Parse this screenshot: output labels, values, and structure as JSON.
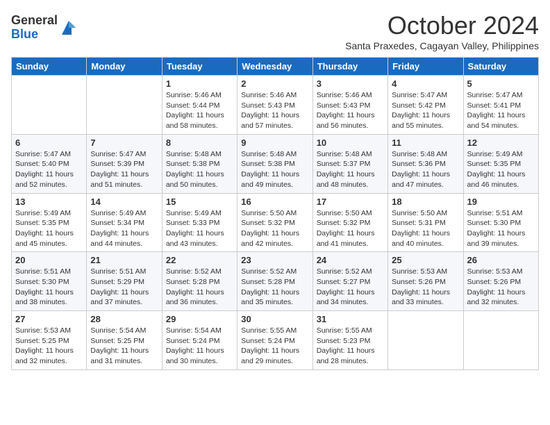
{
  "logo": {
    "general": "General",
    "blue": "Blue"
  },
  "title": "October 2024",
  "subtitle": "Santa Praxedes, Cagayan Valley, Philippines",
  "days_header": [
    "Sunday",
    "Monday",
    "Tuesday",
    "Wednesday",
    "Thursday",
    "Friday",
    "Saturday"
  ],
  "weeks": [
    [
      {
        "day": "",
        "sunrise": "",
        "sunset": "",
        "daylight": ""
      },
      {
        "day": "",
        "sunrise": "",
        "sunset": "",
        "daylight": ""
      },
      {
        "day": "1",
        "sunrise": "Sunrise: 5:46 AM",
        "sunset": "Sunset: 5:44 PM",
        "daylight": "Daylight: 11 hours and 58 minutes."
      },
      {
        "day": "2",
        "sunrise": "Sunrise: 5:46 AM",
        "sunset": "Sunset: 5:43 PM",
        "daylight": "Daylight: 11 hours and 57 minutes."
      },
      {
        "day": "3",
        "sunrise": "Sunrise: 5:46 AM",
        "sunset": "Sunset: 5:43 PM",
        "daylight": "Daylight: 11 hours and 56 minutes."
      },
      {
        "day": "4",
        "sunrise": "Sunrise: 5:47 AM",
        "sunset": "Sunset: 5:42 PM",
        "daylight": "Daylight: 11 hours and 55 minutes."
      },
      {
        "day": "5",
        "sunrise": "Sunrise: 5:47 AM",
        "sunset": "Sunset: 5:41 PM",
        "daylight": "Daylight: 11 hours and 54 minutes."
      }
    ],
    [
      {
        "day": "6",
        "sunrise": "Sunrise: 5:47 AM",
        "sunset": "Sunset: 5:40 PM",
        "daylight": "Daylight: 11 hours and 52 minutes."
      },
      {
        "day": "7",
        "sunrise": "Sunrise: 5:47 AM",
        "sunset": "Sunset: 5:39 PM",
        "daylight": "Daylight: 11 hours and 51 minutes."
      },
      {
        "day": "8",
        "sunrise": "Sunrise: 5:48 AM",
        "sunset": "Sunset: 5:38 PM",
        "daylight": "Daylight: 11 hours and 50 minutes."
      },
      {
        "day": "9",
        "sunrise": "Sunrise: 5:48 AM",
        "sunset": "Sunset: 5:38 PM",
        "daylight": "Daylight: 11 hours and 49 minutes."
      },
      {
        "day": "10",
        "sunrise": "Sunrise: 5:48 AM",
        "sunset": "Sunset: 5:37 PM",
        "daylight": "Daylight: 11 hours and 48 minutes."
      },
      {
        "day": "11",
        "sunrise": "Sunrise: 5:48 AM",
        "sunset": "Sunset: 5:36 PM",
        "daylight": "Daylight: 11 hours and 47 minutes."
      },
      {
        "day": "12",
        "sunrise": "Sunrise: 5:49 AM",
        "sunset": "Sunset: 5:35 PM",
        "daylight": "Daylight: 11 hours and 46 minutes."
      }
    ],
    [
      {
        "day": "13",
        "sunrise": "Sunrise: 5:49 AM",
        "sunset": "Sunset: 5:35 PM",
        "daylight": "Daylight: 11 hours and 45 minutes."
      },
      {
        "day": "14",
        "sunrise": "Sunrise: 5:49 AM",
        "sunset": "Sunset: 5:34 PM",
        "daylight": "Daylight: 11 hours and 44 minutes."
      },
      {
        "day": "15",
        "sunrise": "Sunrise: 5:49 AM",
        "sunset": "Sunset: 5:33 PM",
        "daylight": "Daylight: 11 hours and 43 minutes."
      },
      {
        "day": "16",
        "sunrise": "Sunrise: 5:50 AM",
        "sunset": "Sunset: 5:32 PM",
        "daylight": "Daylight: 11 hours and 42 minutes."
      },
      {
        "day": "17",
        "sunrise": "Sunrise: 5:50 AM",
        "sunset": "Sunset: 5:32 PM",
        "daylight": "Daylight: 11 hours and 41 minutes."
      },
      {
        "day": "18",
        "sunrise": "Sunrise: 5:50 AM",
        "sunset": "Sunset: 5:31 PM",
        "daylight": "Daylight: 11 hours and 40 minutes."
      },
      {
        "day": "19",
        "sunrise": "Sunrise: 5:51 AM",
        "sunset": "Sunset: 5:30 PM",
        "daylight": "Daylight: 11 hours and 39 minutes."
      }
    ],
    [
      {
        "day": "20",
        "sunrise": "Sunrise: 5:51 AM",
        "sunset": "Sunset: 5:30 PM",
        "daylight": "Daylight: 11 hours and 38 minutes."
      },
      {
        "day": "21",
        "sunrise": "Sunrise: 5:51 AM",
        "sunset": "Sunset: 5:29 PM",
        "daylight": "Daylight: 11 hours and 37 minutes."
      },
      {
        "day": "22",
        "sunrise": "Sunrise: 5:52 AM",
        "sunset": "Sunset: 5:28 PM",
        "daylight": "Daylight: 11 hours and 36 minutes."
      },
      {
        "day": "23",
        "sunrise": "Sunrise: 5:52 AM",
        "sunset": "Sunset: 5:28 PM",
        "daylight": "Daylight: 11 hours and 35 minutes."
      },
      {
        "day": "24",
        "sunrise": "Sunrise: 5:52 AM",
        "sunset": "Sunset: 5:27 PM",
        "daylight": "Daylight: 11 hours and 34 minutes."
      },
      {
        "day": "25",
        "sunrise": "Sunrise: 5:53 AM",
        "sunset": "Sunset: 5:26 PM",
        "daylight": "Daylight: 11 hours and 33 minutes."
      },
      {
        "day": "26",
        "sunrise": "Sunrise: 5:53 AM",
        "sunset": "Sunset: 5:26 PM",
        "daylight": "Daylight: 11 hours and 32 minutes."
      }
    ],
    [
      {
        "day": "27",
        "sunrise": "Sunrise: 5:53 AM",
        "sunset": "Sunset: 5:25 PM",
        "daylight": "Daylight: 11 hours and 32 minutes."
      },
      {
        "day": "28",
        "sunrise": "Sunrise: 5:54 AM",
        "sunset": "Sunset: 5:25 PM",
        "daylight": "Daylight: 11 hours and 31 minutes."
      },
      {
        "day": "29",
        "sunrise": "Sunrise: 5:54 AM",
        "sunset": "Sunset: 5:24 PM",
        "daylight": "Daylight: 11 hours and 30 minutes."
      },
      {
        "day": "30",
        "sunrise": "Sunrise: 5:55 AM",
        "sunset": "Sunset: 5:24 PM",
        "daylight": "Daylight: 11 hours and 29 minutes."
      },
      {
        "day": "31",
        "sunrise": "Sunrise: 5:55 AM",
        "sunset": "Sunset: 5:23 PM",
        "daylight": "Daylight: 11 hours and 28 minutes."
      },
      {
        "day": "",
        "sunrise": "",
        "sunset": "",
        "daylight": ""
      },
      {
        "day": "",
        "sunrise": "",
        "sunset": "",
        "daylight": ""
      }
    ]
  ]
}
